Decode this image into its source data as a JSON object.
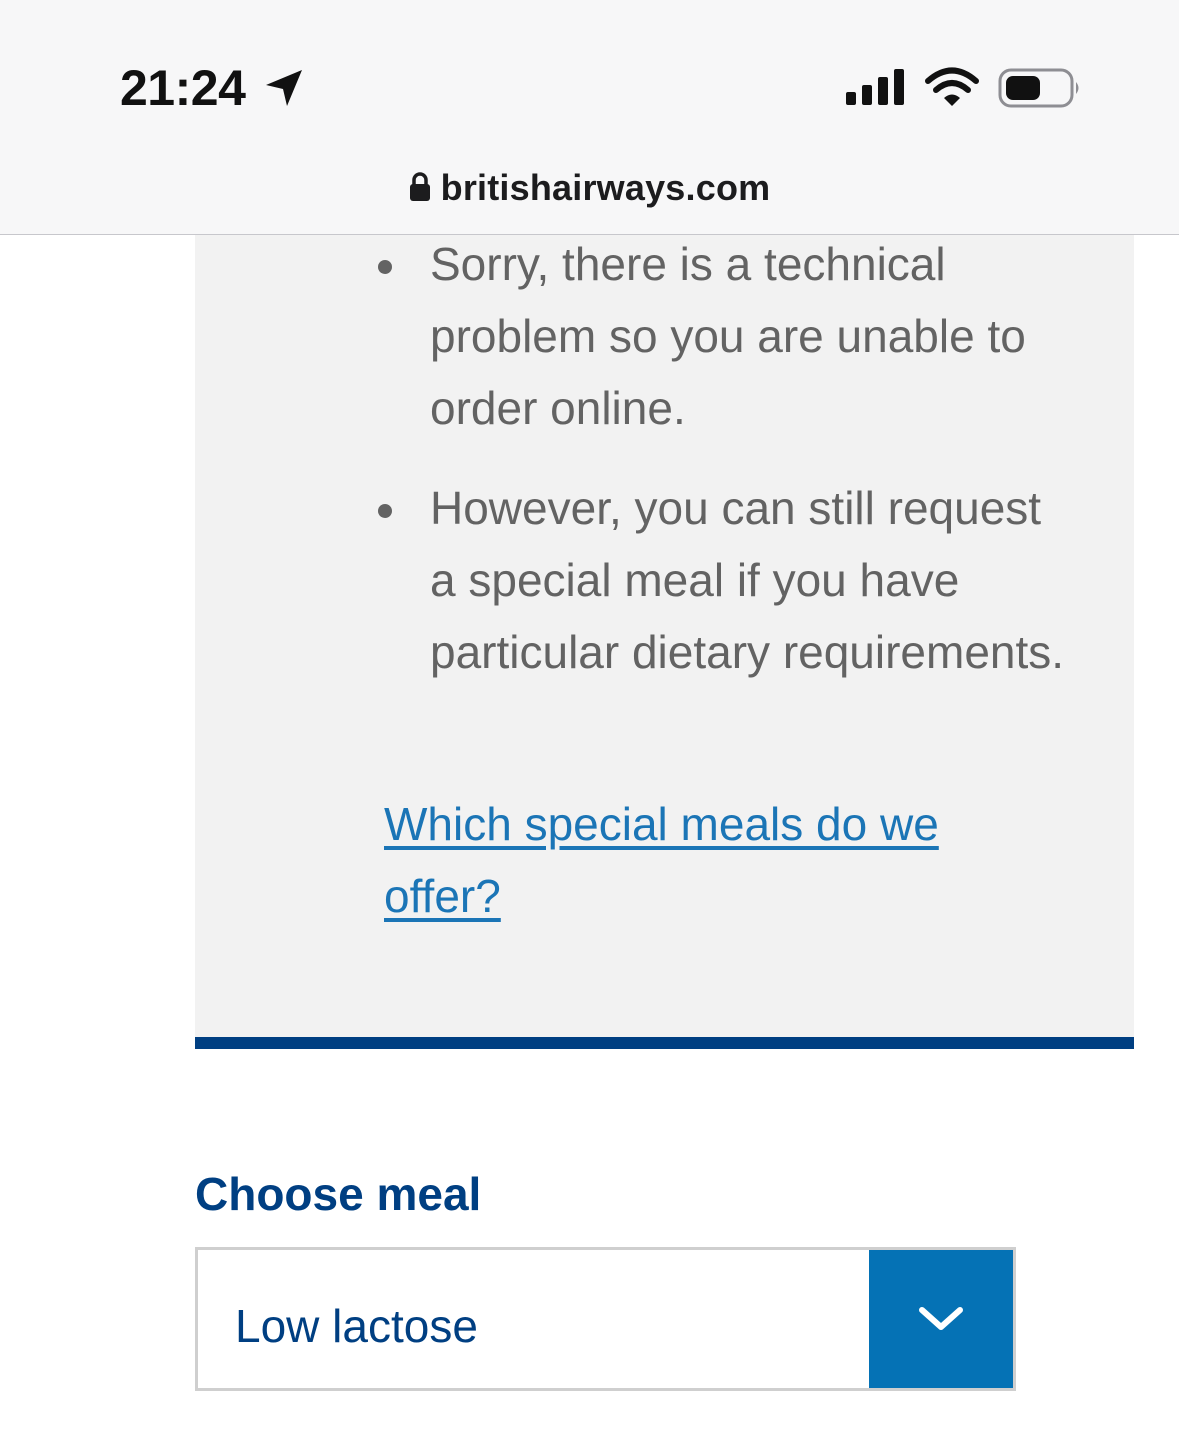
{
  "status_bar": {
    "time": "21:24",
    "icons": [
      "location-arrow-icon",
      "signal-icon",
      "wifi-icon",
      "battery-icon"
    ]
  },
  "browser": {
    "url": "britishairways.com",
    "secure_icon": "lock-icon"
  },
  "info_panel": {
    "items": [
      "Sorry, there is a technical problem so you are unable to order online.",
      "However, you can still request a special meal if you have particular dietary requirements."
    ],
    "link_text": "Which special meals do we offer?"
  },
  "meal_selector": {
    "label": "Choose meal",
    "selected_value": "Low lactose",
    "arrow_icon": "chevron-down-icon"
  },
  "colors": {
    "brand_navy": "#003f82",
    "link_blue": "#1b75b6",
    "select_button_blue": "#0572b5",
    "panel_grey": "#f2f2f2",
    "body_text_grey": "#636363"
  }
}
